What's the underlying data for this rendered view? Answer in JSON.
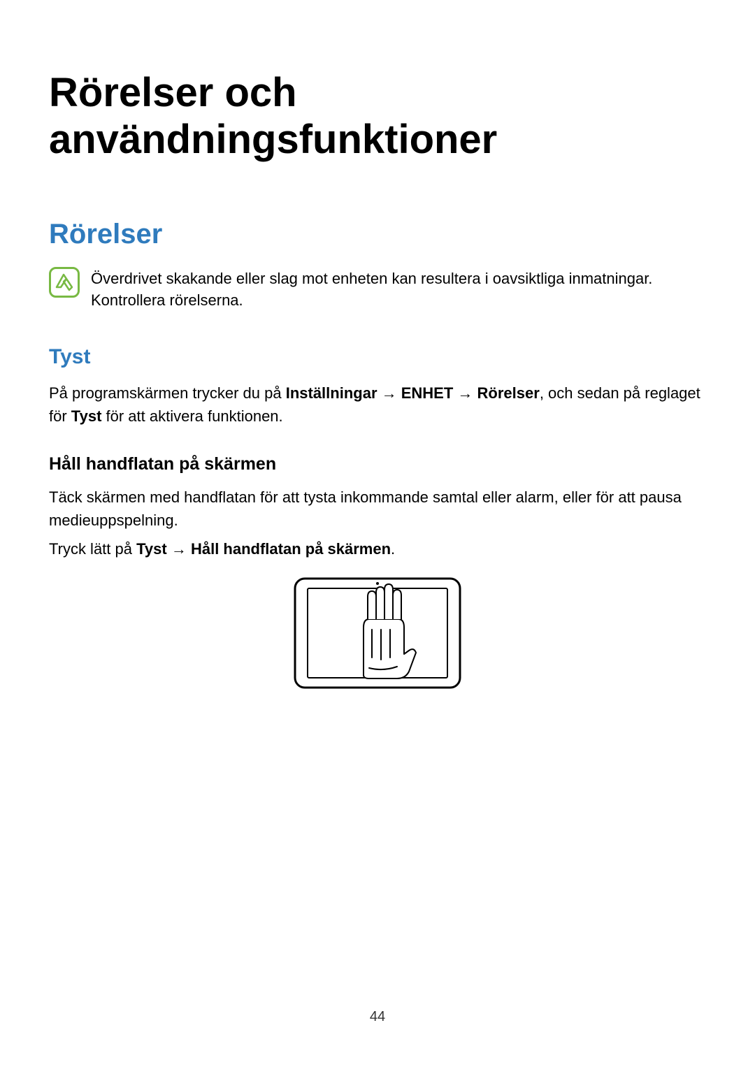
{
  "mainTitle": "Rörelser och användningsfunktioner",
  "sectionTitle": "Rörelser",
  "noteText": "Överdrivet skakande eller slag mot enheten kan resultera i oavsiktliga inmatningar. Kontrollera rörelserna.",
  "subsectionTitle": "Tyst",
  "para1": {
    "pre": "På programskärmen trycker du på ",
    "b1": "Inställningar",
    "arrow1": " → ",
    "b2": "ENHET",
    "arrow2": " → ",
    "b3": "Rörelser",
    "mid": ", och sedan på reglaget för ",
    "b4": "Tyst",
    "post": " för att aktivera funktionen."
  },
  "subHeading": "Håll handflatan på skärmen",
  "para2": "Täck skärmen med handflatan för att tysta inkommande samtal eller alarm, eller för att pausa medieuppspelning.",
  "para3": {
    "pre": "Tryck lätt på ",
    "b1": "Tyst",
    "arrow": " → ",
    "b2": "Håll handflatan på skärmen",
    "post": "."
  },
  "pageNumber": "44"
}
